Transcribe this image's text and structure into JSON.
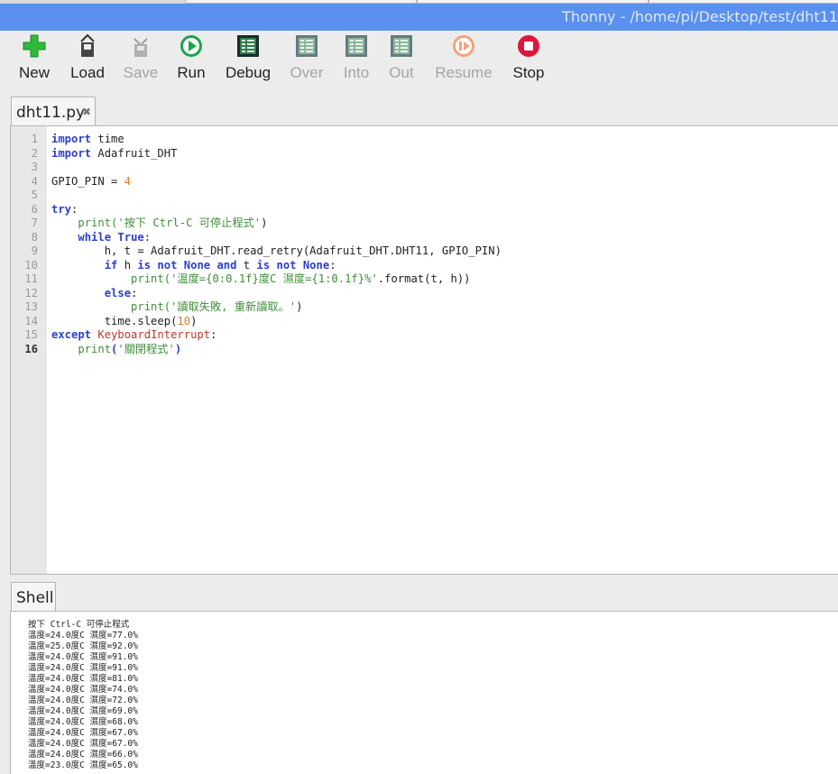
{
  "window": {
    "title": "Thonny  -  /home/pi/Desktop/test/dht11"
  },
  "toolbar": {
    "new": "New",
    "load": "Load",
    "save": "Save",
    "run": "Run",
    "debug": "Debug",
    "over": "Over",
    "into": "Into",
    "out": "Out",
    "resume": "Resume",
    "stop": "Stop"
  },
  "editor": {
    "tab_label": "dht11.py",
    "tab_close": "✖",
    "line_numbers": [
      "1",
      "2",
      "3",
      "4",
      "5",
      "6",
      "7",
      "8",
      "9",
      "10",
      "11",
      "12",
      "13",
      "14",
      "15",
      "16"
    ],
    "lines": [
      [
        {
          "t": "import",
          "c": "kw"
        },
        {
          "t": " time",
          "c": ""
        }
      ],
      [
        {
          "t": "import",
          "c": "kw"
        },
        {
          "t": " Adafruit_DHT",
          "c": ""
        }
      ],
      [],
      [
        {
          "t": "GPIO_PIN = ",
          "c": ""
        },
        {
          "t": "4",
          "c": "num"
        }
      ],
      [],
      [
        {
          "t": "try",
          "c": "kw"
        },
        {
          "t": ":",
          "c": ""
        }
      ],
      [
        {
          "t": "    print(",
          "c": "str"
        },
        {
          "t": "'按下 Ctrl-C 可停止程式'",
          "c": "str"
        },
        {
          "t": ")",
          "c": ""
        }
      ],
      [
        {
          "t": "    ",
          "c": ""
        },
        {
          "t": "while",
          "c": "kw"
        },
        {
          "t": " ",
          "c": ""
        },
        {
          "t": "True",
          "c": "kw"
        },
        {
          "t": ":",
          "c": ""
        }
      ],
      [
        {
          "t": "        h, t = Adafruit_DHT.read_retry(Adafruit_DHT.DHT11, GPIO_PIN)",
          "c": ""
        }
      ],
      [
        {
          "t": "        ",
          "c": ""
        },
        {
          "t": "if",
          "c": "kw"
        },
        {
          "t": " h ",
          "c": ""
        },
        {
          "t": "is not None and",
          "c": "kw"
        },
        {
          "t": " t ",
          "c": ""
        },
        {
          "t": "is not None",
          "c": "kw"
        },
        {
          "t": ":",
          "c": ""
        }
      ],
      [
        {
          "t": "            print(",
          "c": "str"
        },
        {
          "t": "'溫度={0:0.1f}度C 濕度={1:0.1f}%'",
          "c": "str"
        },
        {
          "t": ".format(t, h))",
          "c": ""
        }
      ],
      [
        {
          "t": "        ",
          "c": ""
        },
        {
          "t": "else",
          "c": "kw"
        },
        {
          "t": ":",
          "c": ""
        }
      ],
      [
        {
          "t": "            print(",
          "c": "str"
        },
        {
          "t": "'讀取失敗, 重新讀取。'",
          "c": "str"
        },
        {
          "t": ")",
          "c": ""
        }
      ],
      [
        {
          "t": "        time.sleep(",
          "c": ""
        },
        {
          "t": "10",
          "c": "num"
        },
        {
          "t": ")",
          "c": ""
        }
      ],
      [
        {
          "t": "except",
          "c": "kw"
        },
        {
          "t": " ",
          "c": ""
        },
        {
          "t": "KeyboardInterrupt",
          "c": "exc"
        },
        {
          "t": ":",
          "c": ""
        }
      ],
      [
        {
          "t": "    print",
          "c": "str"
        },
        {
          "t": "(",
          "c": "kw"
        },
        {
          "t": "'關閉程式'",
          "c": "str"
        },
        {
          "t": ")",
          "c": "kw"
        }
      ]
    ]
  },
  "shell": {
    "tab_label": "Shell",
    "lines": [
      "按下 Ctrl-C 可停止程式",
      "溫度=24.0度C 濕度=77.0%",
      "溫度=25.0度C 濕度=92.0%",
      "溫度=24.0度C 濕度=91.0%",
      "溫度=24.0度C 濕度=91.0%",
      "溫度=24.0度C 濕度=81.0%",
      "溫度=24.0度C 濕度=74.0%",
      "溫度=24.0度C 濕度=72.0%",
      "溫度=24.0度C 濕度=69.0%",
      "溫度=24.0度C 濕度=68.0%",
      "溫度=24.0度C 濕度=67.0%",
      "溫度=24.0度C 濕度=67.0%",
      "溫度=24.0度C 濕度=66.0%",
      "溫度=23.0度C 濕度=65.0%"
    ]
  },
  "colors": {
    "titlebar": "#5a90ee",
    "keyword": "#2c3fd1",
    "string": "#3f8d3a",
    "number": "#d97c2b",
    "stop": "#e0143c",
    "run": "#1aa64a"
  }
}
